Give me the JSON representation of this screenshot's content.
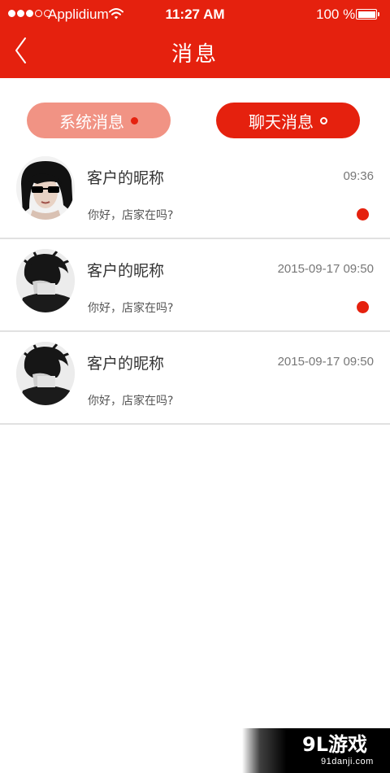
{
  "status_bar": {
    "carrier": "Applidium",
    "time": "11:27 AM",
    "battery": "100 %"
  },
  "nav": {
    "title": "消息",
    "back_icon": "chevron-left-icon"
  },
  "tabs": [
    {
      "label": "系统消息",
      "indicator": "filled-dot",
      "active": false
    },
    {
      "label": "聊天消息",
      "indicator": "ring-dot",
      "active": true
    }
  ],
  "messages": [
    {
      "nickname": "客户的昵称",
      "preview": "你好，店家在吗?",
      "time": "09:36",
      "unread": true
    },
    {
      "nickname": "客户的昵称",
      "preview": "你好，店家在吗?",
      "time": "2015-09-17 09:50",
      "unread": true
    },
    {
      "nickname": "客户的昵称",
      "preview": "你好，店家在吗?",
      "time": "2015-09-17 09:50",
      "unread": false
    }
  ],
  "watermark": {
    "logo": "9L游戏",
    "domain": "91danji.com"
  },
  "colors": {
    "brand_red": "#e5210e",
    "tab_inactive": "#f19384",
    "divider": "#e1e1e1"
  }
}
